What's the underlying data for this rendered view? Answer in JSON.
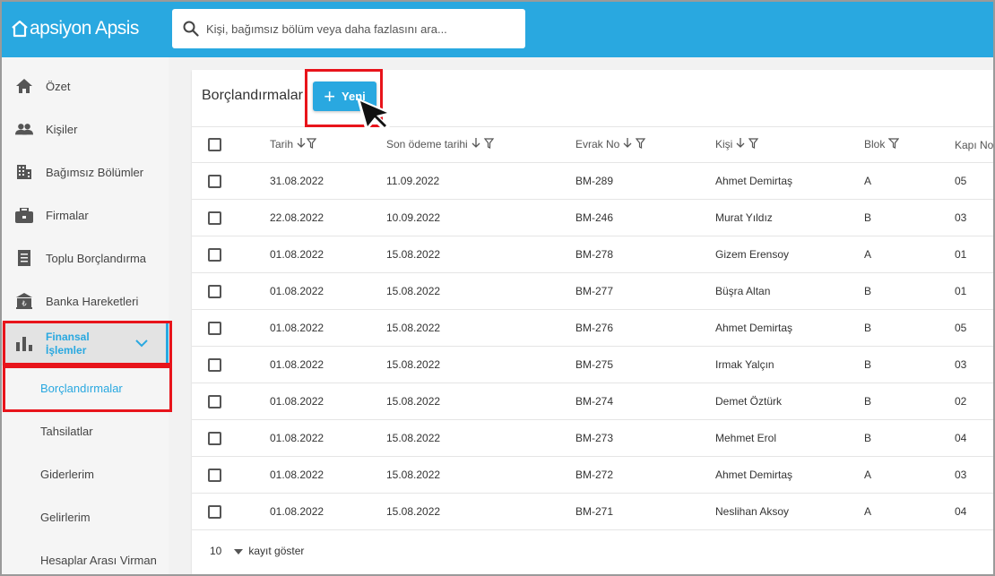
{
  "app": {
    "logo_text": "apsiyon Apsis"
  },
  "search": {
    "placeholder": "Kişi, bağımsız bölüm veya daha fazlasını ara..."
  },
  "sidebar": {
    "items": [
      {
        "label": "Özet",
        "icon": "home-icon"
      },
      {
        "label": "Kişiler",
        "icon": "people-icon"
      },
      {
        "label": "Bağımsız Bölümler",
        "icon": "building-icon"
      },
      {
        "label": "Firmalar",
        "icon": "briefcase-icon"
      },
      {
        "label": "Toplu Borçlandırma",
        "icon": "receipt-icon"
      },
      {
        "label": "Banka Hareketleri",
        "icon": "bank-icon"
      },
      {
        "label": "Finansal\nİşlemler",
        "icon": "bar-chart-icon"
      }
    ],
    "sub_items": [
      {
        "label": "Borçlandırmalar"
      },
      {
        "label": "Tahsilatlar"
      },
      {
        "label": "Giderlerim"
      },
      {
        "label": "Gelirlerim"
      },
      {
        "label": "Hesaplar Arası Virman"
      }
    ]
  },
  "main": {
    "title": "Borçlandırmalar",
    "new_button": "Yeni",
    "columns": [
      "Tarih",
      "Son ödeme tarihi",
      "Evrak No",
      "Kişi",
      "Blok",
      "Kapı No"
    ],
    "rows": [
      [
        "31.08.2022",
        "11.09.2022",
        "BM-289",
        "Ahmet Demirtaş",
        "A",
        "05"
      ],
      [
        "22.08.2022",
        "10.09.2022",
        "BM-246",
        "Murat Yıldız",
        "B",
        "03"
      ],
      [
        "01.08.2022",
        "15.08.2022",
        "BM-278",
        "Gizem Erensoy",
        "A",
        "01"
      ],
      [
        "01.08.2022",
        "15.08.2022",
        "BM-277",
        "Büşra Altan",
        "B",
        "01"
      ],
      [
        "01.08.2022",
        "15.08.2022",
        "BM-276",
        "Ahmet Demirtaş",
        "B",
        "05"
      ],
      [
        "01.08.2022",
        "15.08.2022",
        "BM-275",
        "Irmak Yalçın",
        "B",
        "03"
      ],
      [
        "01.08.2022",
        "15.08.2022",
        "BM-274",
        "Demet Öztürk",
        "B",
        "02"
      ],
      [
        "01.08.2022",
        "15.08.2022",
        "BM-273",
        "Mehmet Erol",
        "B",
        "04"
      ],
      [
        "01.08.2022",
        "15.08.2022",
        "BM-272",
        "Ahmet Demirtaş",
        "A",
        "03"
      ],
      [
        "01.08.2022",
        "15.08.2022",
        "BM-271",
        "Neslihan Aksoy",
        "A",
        "04"
      ]
    ],
    "page_size": "10",
    "page_size_label": "kayıt göster"
  },
  "colors": {
    "brand": "#29a8e0",
    "highlight": "#e8141b"
  }
}
